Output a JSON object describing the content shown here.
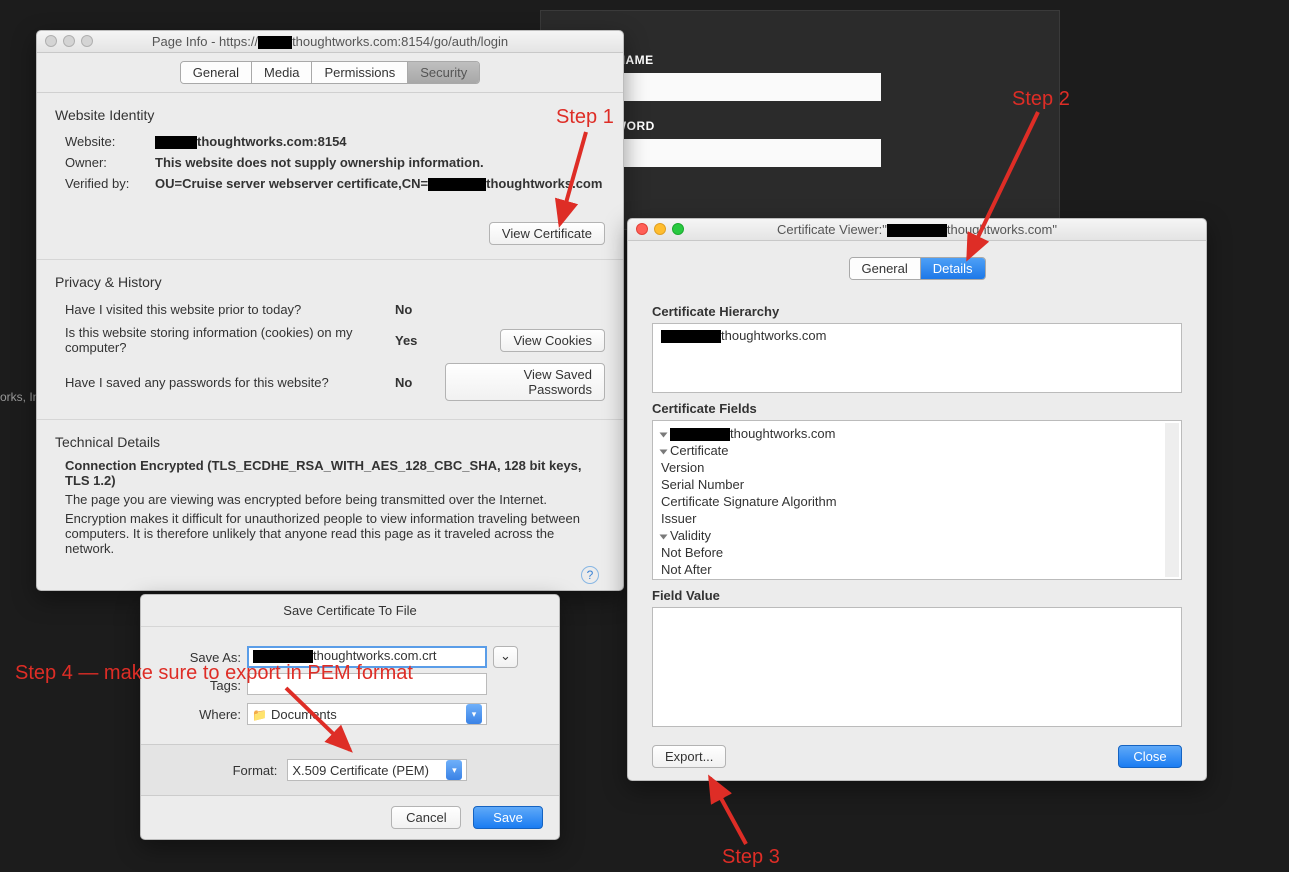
{
  "background": {
    "login": {
      "username_label": "USERNAME",
      "password_label": "PASSWORD"
    },
    "footer_text": "orks, In"
  },
  "page_info": {
    "title_prefix": "Page Info - https://",
    "title_suffix": "thoughtworks.com:8154/go/auth/login",
    "tabs": [
      "General",
      "Media",
      "Permissions",
      "Security"
    ],
    "selected_tab": "Security",
    "identity": {
      "heading": "Website Identity",
      "website_label": "Website:",
      "website_suffix": "thoughtworks.com:8154",
      "owner_label": "Owner:",
      "owner_value": "This website does not supply ownership information.",
      "verified_label": "Verified by:",
      "verified_prefix": "OU=Cruise server webserver certificate,CN=",
      "verified_suffix": "thoughtworks.com",
      "view_cert_btn": "View Certificate"
    },
    "privacy": {
      "heading": "Privacy & History",
      "q1": "Have I visited this website prior to today?",
      "a1": "No",
      "q2": "Is this website storing information (cookies) on my computer?",
      "a2": "Yes",
      "b2": "View Cookies",
      "q3": "Have I saved any passwords for this website?",
      "a3": "No",
      "b3": "View Saved Passwords"
    },
    "technical": {
      "heading": "Technical Details",
      "line1": "Connection Encrypted (TLS_ECDHE_RSA_WITH_AES_128_CBC_SHA, 128 bit keys, TLS 1.2)",
      "line2": "The page you are viewing was encrypted before being transmitted over the Internet.",
      "line3": "Encryption makes it difficult for unauthorized people to view information traveling between computers. It is therefore unlikely that anyone read this page as it traveled across the network."
    }
  },
  "cert_viewer": {
    "title_prefix": "Certificate Viewer:\"",
    "title_suffix": "thoughtworks.com\"",
    "tabs": [
      "General",
      "Details"
    ],
    "hierarchy_heading": "Certificate Hierarchy",
    "hierarchy_item_suffix": "thoughtworks.com",
    "fields_heading": "Certificate Fields",
    "fields": {
      "root_suffix": "thoughtworks.com",
      "cert": "Certificate",
      "version": "Version",
      "serial": "Serial Number",
      "sigalg": "Certificate Signature Algorithm",
      "issuer": "Issuer",
      "validity": "Validity",
      "notbefore": "Not Before",
      "notafter": "Not After"
    },
    "value_heading": "Field Value",
    "export_btn": "Export...",
    "close_btn": "Close"
  },
  "save_dialog": {
    "title": "Save Certificate To File",
    "saveas_label": "Save As:",
    "saveas_value_suffix": "thoughtworks.com.crt",
    "tags_label": "Tags:",
    "where_label": "Where:",
    "where_value": "Documents",
    "format_label": "Format:",
    "format_value": "X.509 Certificate (PEM)",
    "cancel_btn": "Cancel",
    "save_btn": "Save"
  },
  "annotations": {
    "step1": "Step 1",
    "step2": "Step 2",
    "step3": "Step 3",
    "step4": "Step 4 — make sure to export in PEM format"
  }
}
